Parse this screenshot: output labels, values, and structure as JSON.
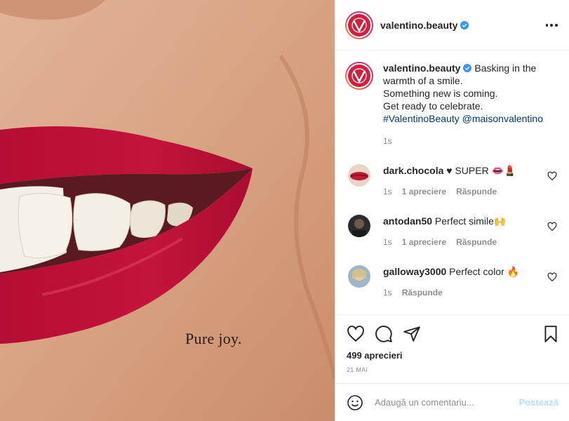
{
  "photo": {
    "overlay_text": "Pure joy."
  },
  "header": {
    "username": "valentino.beauty"
  },
  "caption": {
    "username": "valentino.beauty",
    "line1": "Basking in the warmth of a smile.",
    "line2": "Something new is coming.",
    "line3": "Get ready to celebrate.",
    "hashtag": "#ValentinoBeauty",
    "mention": "@maisonvalentino",
    "time": "1s"
  },
  "comments": [
    {
      "username": "dark.chocola",
      "text": "♥ SUPER 👄💄",
      "time": "1s",
      "likes": "1 apreciere",
      "reply": "Răspunde"
    },
    {
      "username": "antodan50",
      "text": "Perfect simile🙌",
      "time": "1s",
      "likes": "1 apreciere",
      "reply": "Răspunde"
    },
    {
      "username": "galloway3000",
      "text": "Perfect color 🔥",
      "time": "1s",
      "likes": "",
      "reply": "Răspunde"
    }
  ],
  "stats": {
    "likes": "499 aprecieri",
    "date": "21 MAI"
  },
  "add_comment": {
    "placeholder": "Adaugă un comentariu...",
    "post_label": "Postează"
  },
  "colors": {
    "brand": "#d11f3e",
    "link": "#00376b",
    "muted": "#8e8e8e",
    "post_disabled": "#b2dffc",
    "verified": "#3897f0"
  }
}
